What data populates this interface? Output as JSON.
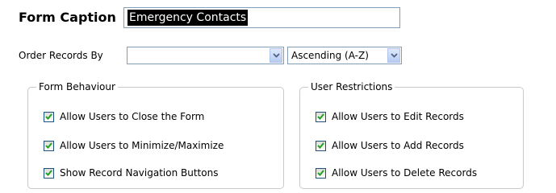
{
  "form_caption": {
    "label": "Form Caption",
    "value": "Emergency Contacts"
  },
  "order_records": {
    "label": "Order Records By",
    "field_value": "",
    "direction_value": "Ascending (A-Z)"
  },
  "form_behaviour": {
    "title": "Form Behaviour",
    "options": [
      {
        "label": "Allow Users to Close the Form",
        "checked": true
      },
      {
        "label": "Allow Users to Minimize/Maximize",
        "checked": true
      },
      {
        "label": "Show Record Navigation Buttons",
        "checked": true
      }
    ]
  },
  "user_restrictions": {
    "title": "User Restrictions",
    "options": [
      {
        "label": "Allow Users to Edit Records",
        "checked": true
      },
      {
        "label": "Allow Users to Add Records",
        "checked": true
      },
      {
        "label": "Allow Users to Delete Records",
        "checked": true
      }
    ]
  },
  "colors": {
    "checkmark": "#21a121",
    "arrow": "#4d6185",
    "field_border": "#7f9db9"
  }
}
